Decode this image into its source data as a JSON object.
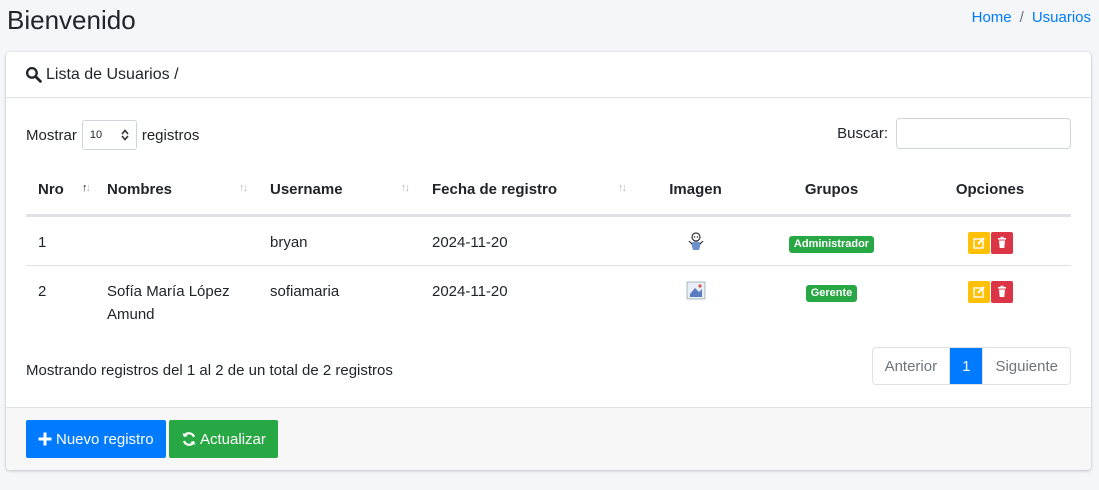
{
  "header": {
    "title": "Bienvenido",
    "breadcrumb": {
      "home": "Home",
      "separator": "/",
      "current": "Usuarios"
    }
  },
  "card": {
    "title": "Lista de Usuarios /",
    "length": {
      "prefix": "Mostrar",
      "value": "10",
      "suffix": "registros"
    },
    "search": {
      "label": "Buscar:",
      "value": ""
    },
    "columns": [
      "Nro",
      "Nombres",
      "Username",
      "Fecha de registro",
      "Imagen",
      "Grupos",
      "Opciones"
    ],
    "rows": [
      {
        "nro": "1",
        "nombres": "",
        "username": "bryan",
        "fecha": "2024-11-20",
        "imagen": "avatar-icon",
        "grupo": "Administrador",
        "grupo_color": "#28a745"
      },
      {
        "nro": "2",
        "nombres": "Sofía María López Amund",
        "username": "sofiamaria",
        "fecha": "2024-11-20",
        "imagen": "avatar-icon",
        "grupo": "Gerente",
        "grupo_color": "#28a745"
      }
    ],
    "info": "Mostrando registros del 1 al 2 de un total de 2 registros",
    "pagination": {
      "prev": "Anterior",
      "current": "1",
      "next": "Siguiente"
    },
    "footer": {
      "new_label": "Nuevo registro",
      "refresh_label": "Actualizar"
    }
  },
  "colors": {
    "primary": "#007bff",
    "success": "#28a745",
    "warning": "#ffc107",
    "danger": "#dc3545"
  }
}
